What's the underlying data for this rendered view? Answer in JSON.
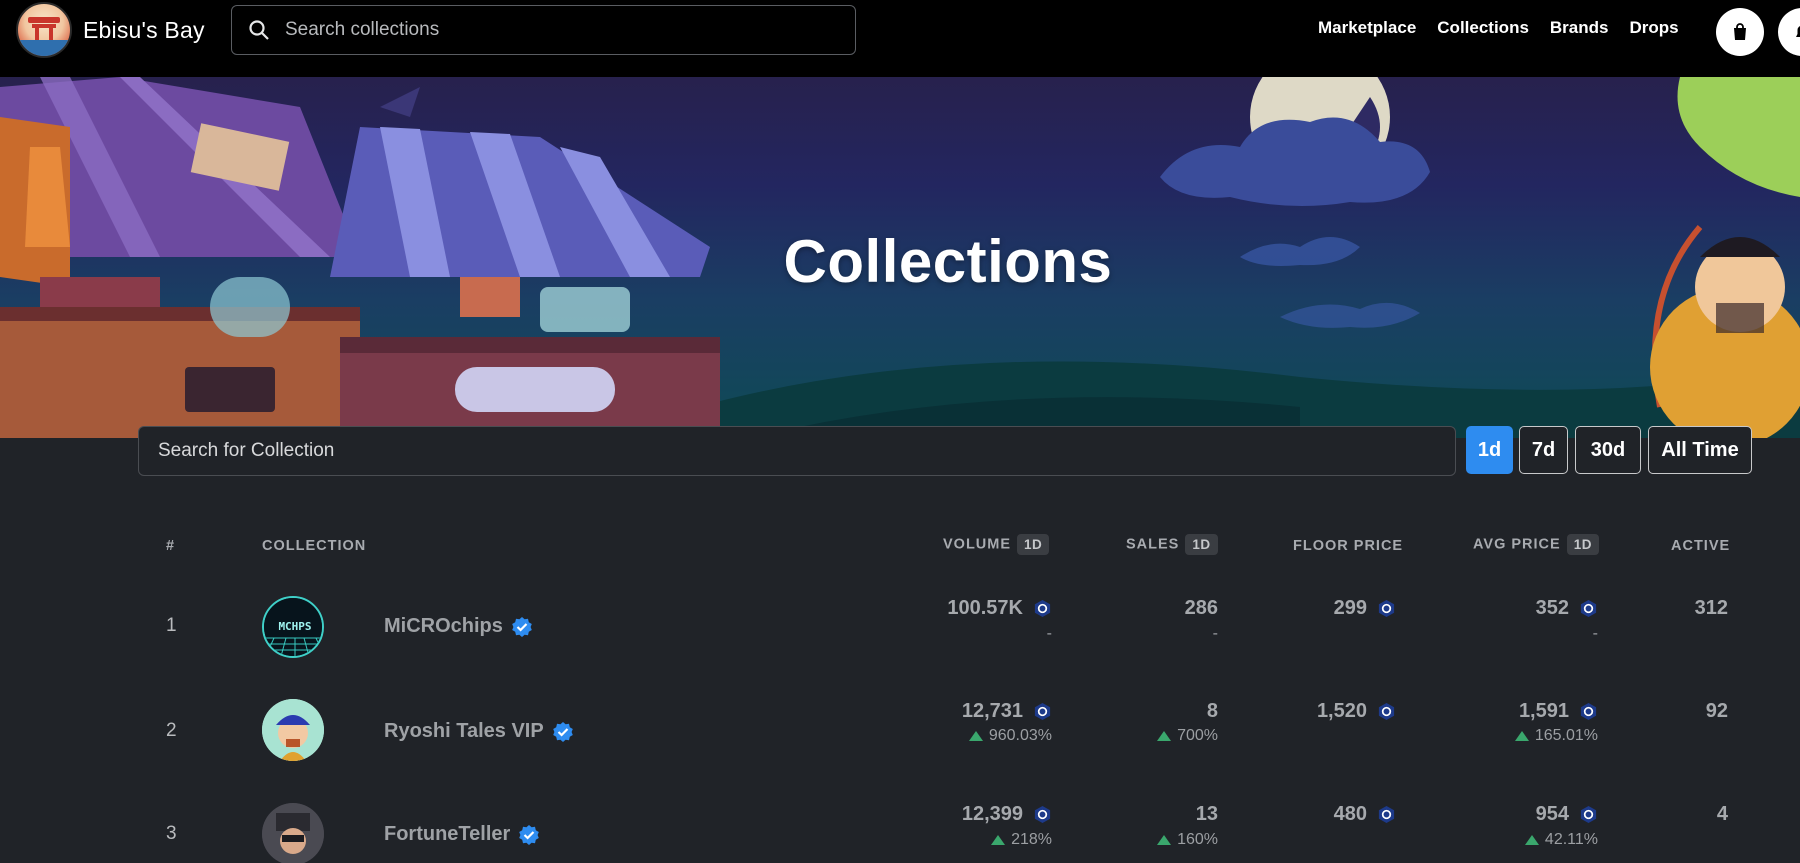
{
  "nav": {
    "brand": "Ebisu's Bay",
    "search_placeholder": "Search collections",
    "links": [
      "Marketplace",
      "Collections",
      "Brands",
      "Drops"
    ]
  },
  "hero": {
    "title": "Collections"
  },
  "filters": {
    "search_placeholder": "Search for Collection",
    "timeframes": [
      "1d",
      "7d",
      "30d",
      "All Time"
    ],
    "active_timeframe": "1d"
  },
  "table": {
    "headers": {
      "rank": "#",
      "collection": "COLLECTION",
      "volume": "VOLUME",
      "volume_badge": "1D",
      "sales": "SALES",
      "sales_badge": "1D",
      "floor": "FLOOR PRICE",
      "avg": "AVG PRICE",
      "avg_badge": "1D",
      "active": "ACTIVE"
    },
    "rows": [
      {
        "rank": "1",
        "name": "MiCROchips",
        "volume": "100.57K",
        "volume_change": "-",
        "sales": "286",
        "sales_change": "-",
        "floor": "299",
        "avg": "352",
        "avg_change": "-",
        "active": "312"
      },
      {
        "rank": "2",
        "name": "Ryoshi Tales VIP",
        "volume": "12,731",
        "volume_change": "960.03%",
        "sales": "8",
        "sales_change": "700%",
        "floor": "1,520",
        "avg": "1,591",
        "avg_change": "165.01%",
        "active": "92"
      },
      {
        "rank": "3",
        "name": "FortuneTeller",
        "volume": "12,399",
        "volume_change": "218%",
        "sales": "13",
        "sales_change": "160%",
        "floor": "480",
        "avg": "954",
        "avg_change": "42.11%",
        "active": "4"
      }
    ]
  },
  "colors": {
    "background": "#202328",
    "navbar": "#000000",
    "accent": "#2e8cf0",
    "positive": "#3aa76d",
    "verified": "#2e8cf0",
    "cro": "#1d3a8a"
  },
  "icons": {
    "search": "search-icon",
    "cart": "shopping-bag-icon",
    "notifications": "bell-icon",
    "verified": "verified-check-icon",
    "currency": "cro-token-icon",
    "change_up": "triangle-up-icon"
  }
}
